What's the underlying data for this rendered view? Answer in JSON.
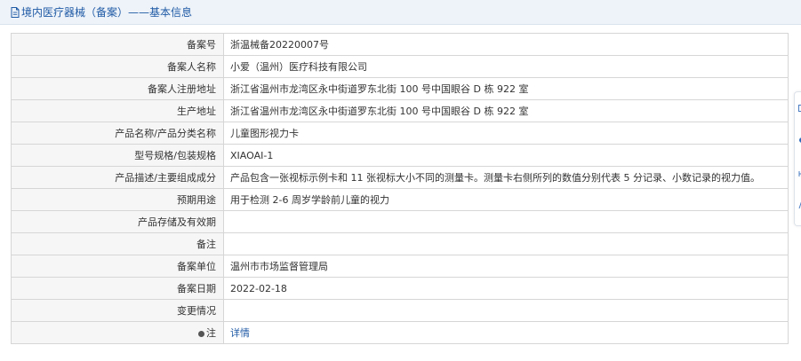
{
  "header": {
    "title": "境内医疗器械（备案）——基本信息"
  },
  "rows": [
    {
      "label": "备案号",
      "value": "浙温械备20220007号"
    },
    {
      "label": "备案人名称",
      "value": "小爱（温州）医疗科技有限公司"
    },
    {
      "label": "备案人注册地址",
      "value": "浙江省温州市龙湾区永中街道罗东北街 100 号中国眼谷 D 栋 922 室"
    },
    {
      "label": "生产地址",
      "value": "浙江省温州市龙湾区永中街道罗东北街 100 号中国眼谷 D 栋 922 室"
    },
    {
      "label": "产品名称/产品分类名称",
      "value": "儿童图形视力卡"
    },
    {
      "label": "型号规格/包装规格",
      "value": "XIAOAI-1"
    },
    {
      "label": "产品描述/主要组成成分",
      "value": "产品包含一张视标示例卡和 11 张视标大小不同的测量卡。测量卡右侧所列的数值分别代表 5 分记录、小数记录的视力值。"
    },
    {
      "label": "预期用途",
      "value": "用于检测 2-6 周岁学龄前儿童的视力"
    },
    {
      "label": "产品存储及有效期",
      "value": ""
    },
    {
      "label": "备注",
      "value": ""
    },
    {
      "label": "备案单位",
      "value": "温州市市场监督管理局"
    },
    {
      "label": "备案日期",
      "value": "2022-02-18"
    },
    {
      "label": "变更情况",
      "value": ""
    }
  ],
  "note_row": {
    "label": "注",
    "link": "详情"
  },
  "colors": {
    "link": "#1f5aa5",
    "label_bg": "#f6f6f6",
    "border": "#d6d6d6",
    "header_bg": "#eef3f9"
  },
  "icons": {
    "title": "document-icon",
    "note": "pin-icon"
  }
}
